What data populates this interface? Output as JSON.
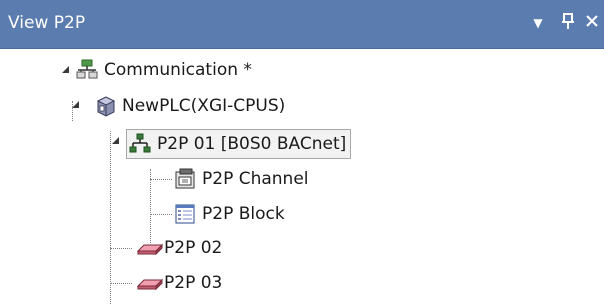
{
  "panel": {
    "title": "View P2P",
    "controls": {
      "menu": "▼",
      "pin": "ᵖ",
      "close": "✕"
    }
  },
  "tree": {
    "root": {
      "label": "Communication *",
      "icon": "network-topology-icon"
    },
    "plc": {
      "label": "NewPLC(XGI-CPUS)",
      "icon": "plc-cube-icon"
    },
    "p2p01": {
      "label": "P2P 01 [B0S0 BACnet]",
      "icon": "network-tree-icon"
    },
    "channel": {
      "label": "P2P Channel",
      "icon": "channel-icon"
    },
    "block": {
      "label": "P2P Block",
      "icon": "block-list-icon"
    },
    "p2p02": {
      "label": "P2P 02",
      "icon": "card-icon"
    },
    "p2p03": {
      "label": "P2P 03",
      "icon": "card-icon"
    }
  },
  "colors": {
    "titlebar": "#5b7cae",
    "selection_border": "#a8a8a8"
  }
}
